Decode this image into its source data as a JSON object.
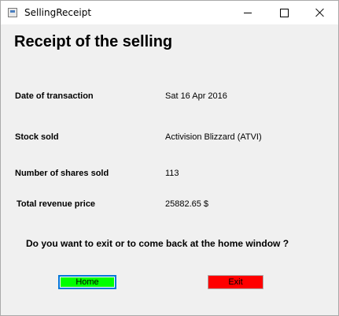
{
  "window": {
    "title": "SellingReceipt",
    "icon": "form-icon"
  },
  "heading": "Receipt of the selling",
  "fields": [
    {
      "label": "Date of transaction",
      "value": "Sat 16 Apr 2016"
    },
    {
      "label": "Stock sold",
      "value": "Activision Blizzard (ATVI)"
    },
    {
      "label": "Number of shares sold",
      "value": "113"
    },
    {
      "label": "Total revenue price",
      "value": "25882.65 $"
    }
  ],
  "question": "Do you want to exit or to come back at the home window ?",
  "buttons": {
    "home_label": "Home",
    "exit_label": "Exit"
  },
  "colors": {
    "home_bg": "#00ff00",
    "exit_bg": "#ff0000",
    "focus_border": "#0078d7",
    "window_bg": "#f0f0f0"
  }
}
